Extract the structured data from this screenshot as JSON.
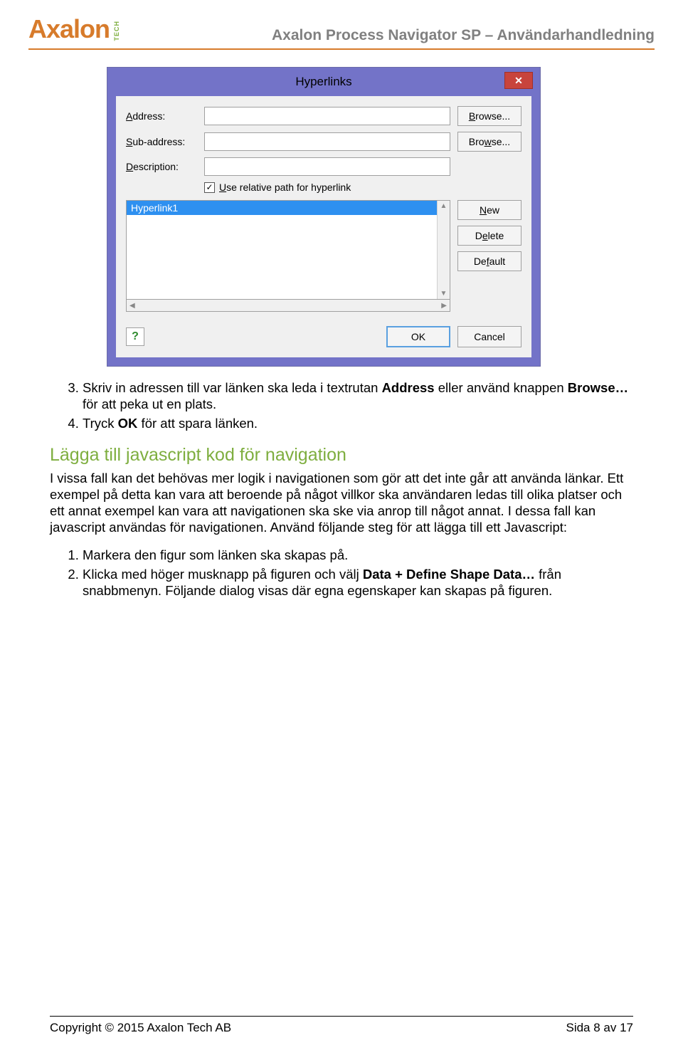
{
  "header": {
    "logo_text": "Axalon",
    "logo_suffix": "TECH",
    "doc_title": "Axalon Process Navigator SP – Användarhandledning"
  },
  "dialog": {
    "title": "Hyperlinks",
    "close_symbol": "✕",
    "labels": {
      "address": "Address:",
      "subaddress": "Sub-address:",
      "description": "Description:"
    },
    "checkbox_label": "Use relative path for hyperlink",
    "checkbox_checked": "✓",
    "buttons": {
      "browse1": "Browse...",
      "browse2": "Browse...",
      "new": "New",
      "delete": "Delete",
      "default": "Default",
      "ok": "OK",
      "cancel": "Cancel"
    },
    "list_selected": "Hyperlink1",
    "help_symbol": "?"
  },
  "body": {
    "ol1_start": 3,
    "li3_a": "Skriv in adressen till var länken ska leda i textrutan ",
    "li3_b": "Address",
    "li3_c": " eller använd knappen ",
    "li3_d": "Browse…",
    "li3_e": " för att peka ut en plats.",
    "li4_a": "Tryck ",
    "li4_b": "OK",
    "li4_c": " för att spara länken.",
    "h2": "Lägga till javascript kod för navigation",
    "p1": "I vissa fall kan det behövas mer logik i navigationen som gör att det inte går att använda länkar. Ett exempel på detta kan vara att beroende på något villkor ska användaren ledas till olika platser och ett annat exempel kan vara att navigationen ska ske via anrop till något annat. I dessa fall kan javascript användas för navigationen. Använd följande steg för att lägga till ett Javascript:",
    "ol2_li1": "Markera den figur som länken ska skapas på.",
    "ol2_li2_a": "Klicka med höger musknapp på figuren och välj ",
    "ol2_li2_b": "Data + Define Shape Data…",
    "ol2_li2_c": " från snabbmenyn. Följande dialog visas där egna egenskaper kan skapas på figuren."
  },
  "footer": {
    "copyright": "Copyright © 2015 Axalon Tech AB",
    "page": "Sida 8 av 17"
  }
}
